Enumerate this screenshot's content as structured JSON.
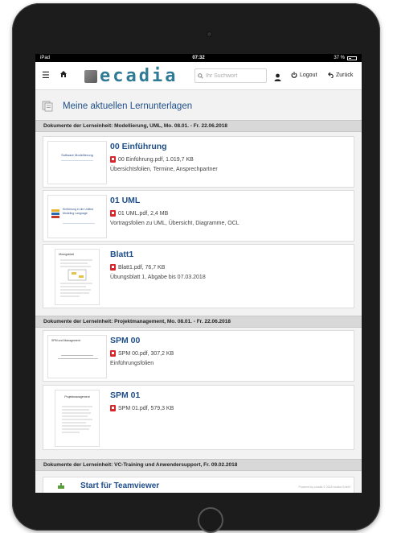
{
  "status_bar": {
    "device": "iPad",
    "time": "07:32",
    "battery": "37 %"
  },
  "navbar": {
    "logo_text": "ecadia",
    "search_placeholder": "Ihr Suchwort",
    "logout_label": "Logout",
    "back_label": "Zurück"
  },
  "page": {
    "title": "Meine aktuellen Lernunterlagen"
  },
  "sections": [
    {
      "header": "Dokumente der Lerneinheit: Modellierung, UML, Mo. 08.01. - Fr. 22.06.2018",
      "items": [
        {
          "title": "00 Einführung",
          "file": "00 Einführung.pdf, 1.019,7 KB",
          "description": "Übersichtsfolien, Termine, Ansprechpartner",
          "thumb_title": "Software Modellierung"
        },
        {
          "title": "01 UML",
          "file": "01 UML.pdf, 2,4 MB",
          "description": "Vortragsfolien zu UML, Übersicht, Diagramme, OCL",
          "thumb_title": "Einführung in die Unified Modeling Language"
        },
        {
          "title": "Blatt1",
          "file": "Blatt1.pdf, 76,7 KB",
          "description": "Übungsblatt 1, Abgabe bis 07.03.2018",
          "thumb_title": "Übungsblatt"
        }
      ]
    },
    {
      "header": "Dokumente der Lerneinheit: Projektmanagement, Mo. 08.01. - Fr. 22.06.2018",
      "items": [
        {
          "title": "SPM 00",
          "file": "SPM 00.pdf, 307,2 KB",
          "description": "Einführungsfolien",
          "thumb_title": "SPM und Management"
        },
        {
          "title": "SPM 01",
          "file": "SPM 01.pdf, 579,3 KB",
          "description": "",
          "thumb_title": "Projektmanagement"
        }
      ]
    },
    {
      "header": "Dokumente der Lerneinheit: VC-Training und Anwendersupport, Fr. 09.02.2018",
      "items": [
        {
          "title": "Start für Teamviewer",
          "footer_note": "Powered by ecadia © 2018 ecadia GmbH"
        }
      ]
    }
  ],
  "colors": {
    "link": "#1f4f8a",
    "logo": "#2f7a94",
    "section_bg": "#d8d8d8",
    "pdf": "#d9262b"
  }
}
